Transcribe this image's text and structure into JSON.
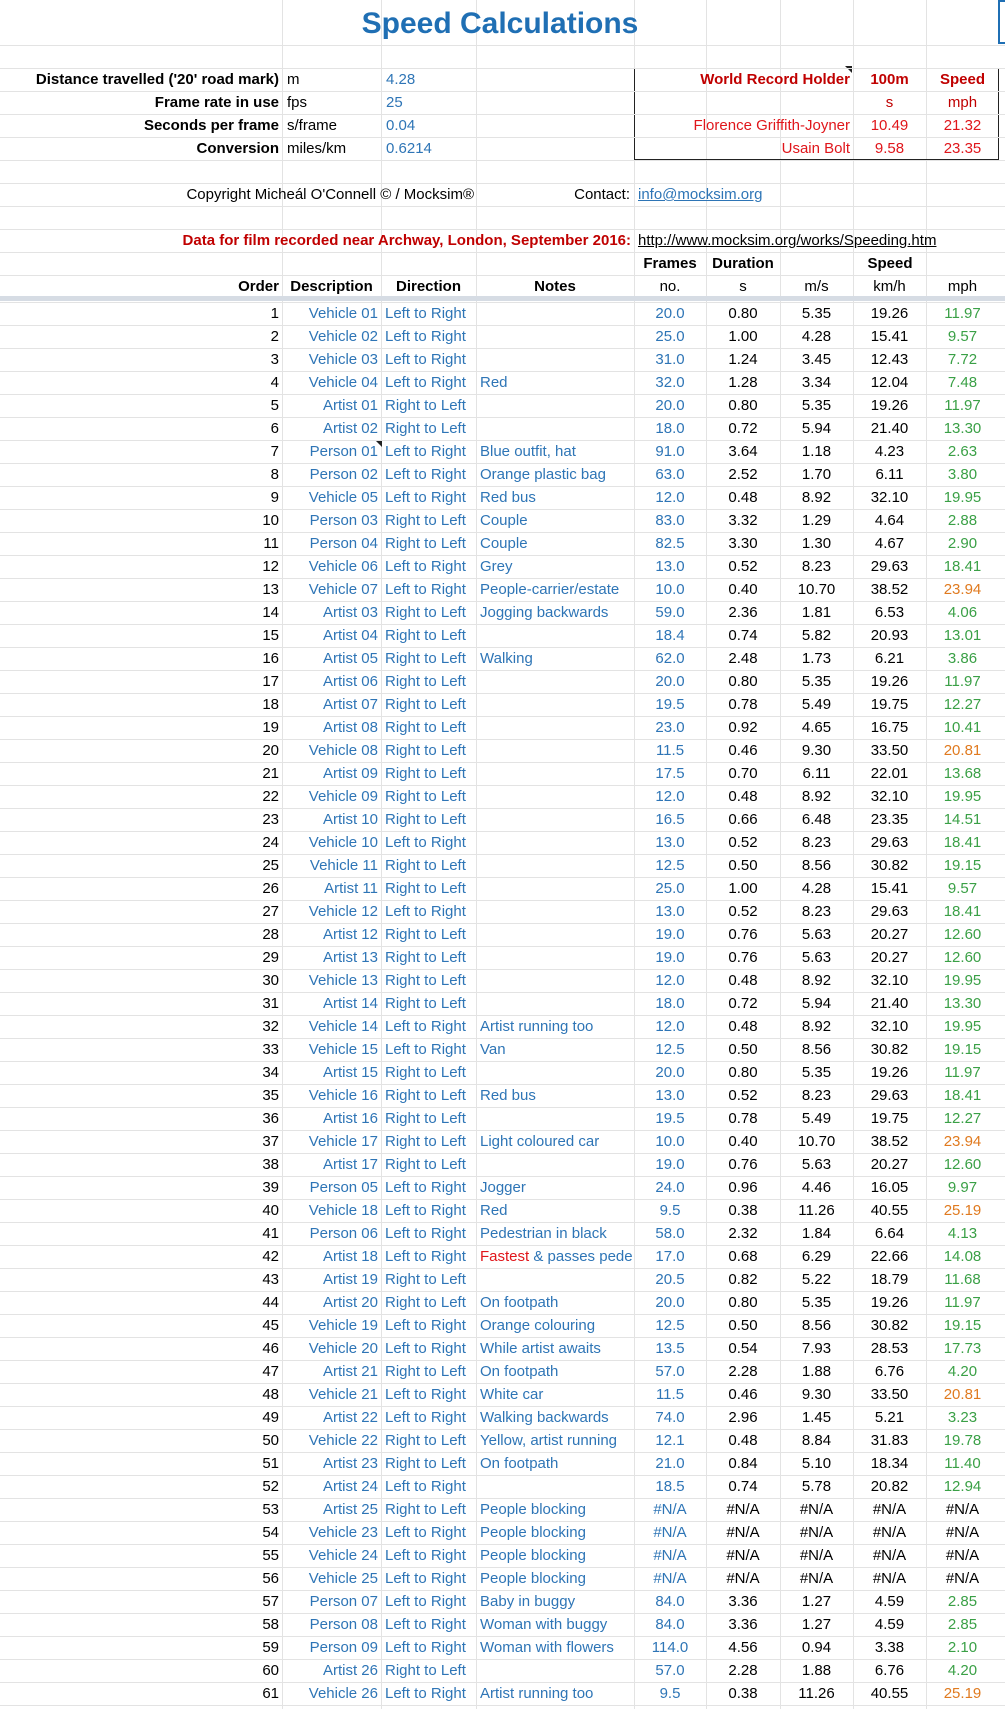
{
  "title": "Speed Calculations",
  "params": [
    {
      "label": "Distance travelled ('20' road mark)",
      "unit": "m",
      "value": "4.28"
    },
    {
      "label": "Frame rate in use",
      "unit": "fps",
      "value": "25"
    },
    {
      "label": "Seconds per frame",
      "unit": "s/frame",
      "value": "0.04"
    },
    {
      "label": "Conversion",
      "unit": "miles/km",
      "value": "0.6214"
    }
  ],
  "world_record": {
    "header": {
      "holder": "World Record Holder",
      "dist": "100m",
      "speed": "Speed"
    },
    "units": {
      "dist": "s",
      "speed": "mph"
    },
    "rows": [
      {
        "name": "Florence Griffith-Joyner",
        "time": "10.49",
        "speed": "21.32"
      },
      {
        "name": "Usain Bolt",
        "time": "9.58",
        "speed": "23.35"
      }
    ]
  },
  "copyright": "Copyright Micheál O'Connell © / Mocksim®",
  "contact_label": "Contact:",
  "contact_email": "info@mocksim.org",
  "data_note": "Data for film recorded near Archway, London, September 2016:",
  "data_url": "http://www.mocksim.org/works/Speeding.htm",
  "headers": {
    "frames": "Frames",
    "duration": "Duration",
    "speed": "Speed",
    "order": "Order",
    "description": "Description",
    "direction": "Direction",
    "notes": "Notes",
    "no": "no.",
    "s": "s",
    "ms": "m/s",
    "kmh": "km/h",
    "mph": "mph"
  },
  "rows": [
    [
      "1",
      "Vehicle 01",
      "Left to Right",
      "",
      "20.0",
      "0.80",
      "5.35",
      "19.26",
      "11.97"
    ],
    [
      "2",
      "Vehicle 02",
      "Left to Right",
      "",
      "25.0",
      "1.00",
      "4.28",
      "15.41",
      "9.57"
    ],
    [
      "3",
      "Vehicle 03",
      "Left to Right",
      "",
      "31.0",
      "1.24",
      "3.45",
      "12.43",
      "7.72"
    ],
    [
      "4",
      "Vehicle 04",
      "Left to Right",
      "Red",
      "32.0",
      "1.28",
      "3.34",
      "12.04",
      "7.48"
    ],
    [
      "5",
      "Artist 01",
      "Right  to Left",
      "",
      "20.0",
      "0.80",
      "5.35",
      "19.26",
      "11.97"
    ],
    [
      "6",
      "Artist 02",
      "Right  to Left",
      "",
      "18.0",
      "0.72",
      "5.94",
      "21.40",
      "13.30"
    ],
    [
      "7",
      "Person 01",
      "Left to Right",
      "Blue outfit, hat",
      "91.0",
      "3.64",
      "1.18",
      "4.23",
      "2.63"
    ],
    [
      "8",
      "Person 02",
      "Left to Right",
      "Orange plastic bag",
      "63.0",
      "2.52",
      "1.70",
      "6.11",
      "3.80"
    ],
    [
      "9",
      "Vehicle 05",
      "Left to Right",
      "Red bus",
      "12.0",
      "0.48",
      "8.92",
      "32.10",
      "19.95"
    ],
    [
      "10",
      "Person 03",
      "Right  to Left",
      "Couple",
      "83.0",
      "3.32",
      "1.29",
      "4.64",
      "2.88"
    ],
    [
      "11",
      "Person 04",
      "Right  to Left",
      "Couple",
      "82.5",
      "3.30",
      "1.30",
      "4.67",
      "2.90"
    ],
    [
      "12",
      "Vehicle 06",
      "Left to Right",
      "Grey",
      "13.0",
      "0.52",
      "8.23",
      "29.63",
      "18.41"
    ],
    [
      "13",
      "Vehicle 07",
      "Left to Right",
      "People-carrier/estate",
      "10.0",
      "0.40",
      "10.70",
      "38.52",
      "23.94"
    ],
    [
      "14",
      "Artist 03",
      "Right  to Left",
      "Jogging backwards",
      "59.0",
      "2.36",
      "1.81",
      "6.53",
      "4.06"
    ],
    [
      "15",
      "Artist 04",
      "Right  to Left",
      "",
      "18.4",
      "0.74",
      "5.82",
      "20.93",
      "13.01"
    ],
    [
      "16",
      "Artist 05",
      "Right  to Left",
      "Walking",
      "62.0",
      "2.48",
      "1.73",
      "6.21",
      "3.86"
    ],
    [
      "17",
      "Artist 06",
      "Right  to Left",
      "",
      "20.0",
      "0.80",
      "5.35",
      "19.26",
      "11.97"
    ],
    [
      "18",
      "Artist 07",
      "Right  to Left",
      "",
      "19.5",
      "0.78",
      "5.49",
      "19.75",
      "12.27"
    ],
    [
      "19",
      "Artist 08",
      "Right  to Left",
      "",
      "23.0",
      "0.92",
      "4.65",
      "16.75",
      "10.41"
    ],
    [
      "20",
      "Vehicle 08",
      "Right  to Left",
      "",
      "11.5",
      "0.46",
      "9.30",
      "33.50",
      "20.81"
    ],
    [
      "21",
      "Artist 09",
      "Right  to Left",
      "",
      "17.5",
      "0.70",
      "6.11",
      "22.01",
      "13.68"
    ],
    [
      "22",
      "Vehicle 09",
      "Right  to Left",
      "",
      "12.0",
      "0.48",
      "8.92",
      "32.10",
      "19.95"
    ],
    [
      "23",
      "Artist 10",
      "Right  to Left",
      "",
      "16.5",
      "0.66",
      "6.48",
      "23.35",
      "14.51"
    ],
    [
      "24",
      "Vehicle 10",
      "Left to Right",
      "",
      "13.0",
      "0.52",
      "8.23",
      "29.63",
      "18.41"
    ],
    [
      "25",
      "Vehicle 11",
      "Right  to Left",
      "",
      "12.5",
      "0.50",
      "8.56",
      "30.82",
      "19.15"
    ],
    [
      "26",
      "Artist 11",
      "Right  to Left",
      "",
      "25.0",
      "1.00",
      "4.28",
      "15.41",
      "9.57"
    ],
    [
      "27",
      "Vehicle 12",
      "Left to Right",
      "",
      "13.0",
      "0.52",
      "8.23",
      "29.63",
      "18.41"
    ],
    [
      "28",
      "Artist 12",
      "Right  to Left",
      "",
      "19.0",
      "0.76",
      "5.63",
      "20.27",
      "12.60"
    ],
    [
      "29",
      "Artist 13",
      "Right  to Left",
      "",
      "19.0",
      "0.76",
      "5.63",
      "20.27",
      "12.60"
    ],
    [
      "30",
      "Vehicle 13",
      "Right  to Left",
      "",
      "12.0",
      "0.48",
      "8.92",
      "32.10",
      "19.95"
    ],
    [
      "31",
      "Artist 14",
      "Right  to Left",
      "",
      "18.0",
      "0.72",
      "5.94",
      "21.40",
      "13.30"
    ],
    [
      "32",
      "Vehicle 14",
      "Left to Right",
      "Artist running too",
      "12.0",
      "0.48",
      "8.92",
      "32.10",
      "19.95"
    ],
    [
      "33",
      "Vehicle 15",
      "Left to Right",
      "Van",
      "12.5",
      "0.50",
      "8.56",
      "30.82",
      "19.15"
    ],
    [
      "34",
      "Artist 15",
      "Right  to Left",
      "",
      "20.0",
      "0.80",
      "5.35",
      "19.26",
      "11.97"
    ],
    [
      "35",
      "Vehicle 16",
      "Right  to Left",
      "Red bus",
      "13.0",
      "0.52",
      "8.23",
      "29.63",
      "18.41"
    ],
    [
      "36",
      "Artist 16",
      "Right  to Left",
      "",
      "19.5",
      "0.78",
      "5.49",
      "19.75",
      "12.27"
    ],
    [
      "37",
      "Vehicle 17",
      "Right  to Left",
      "Light coloured car",
      "10.0",
      "0.40",
      "10.70",
      "38.52",
      "23.94"
    ],
    [
      "38",
      "Artist 17",
      "Right  to Left",
      "",
      "19.0",
      "0.76",
      "5.63",
      "20.27",
      "12.60"
    ],
    [
      "39",
      "Person 05",
      "Left to Right",
      "Jogger",
      "24.0",
      "0.96",
      "4.46",
      "16.05",
      "9.97"
    ],
    [
      "40",
      "Vehicle 18",
      "Left to Right",
      "Red",
      "9.5",
      "0.38",
      "11.26",
      "40.55",
      "25.19"
    ],
    [
      "41",
      "Person 06",
      "Left to Right",
      "Pedestrian in black",
      "58.0",
      "2.32",
      "1.84",
      "6.64",
      "4.13"
    ],
    [
      "42",
      "Artist 18",
      "Left to Right",
      "Fastest & passes pede",
      "17.0",
      "0.68",
      "6.29",
      "22.66",
      "14.08"
    ],
    [
      "43",
      "Artist 19",
      "Right  to Left",
      "",
      "20.5",
      "0.82",
      "5.22",
      "18.79",
      "11.68"
    ],
    [
      "44",
      "Artist 20",
      "Right  to Left",
      "On footpath",
      "20.0",
      "0.80",
      "5.35",
      "19.26",
      "11.97"
    ],
    [
      "45",
      "Vehicle 19",
      "Left to Right",
      "Orange colouring",
      "12.5",
      "0.50",
      "8.56",
      "30.82",
      "19.15"
    ],
    [
      "46",
      "Vehicle 20",
      "Left to Right",
      "While artist awaits",
      "13.5",
      "0.54",
      "7.93",
      "28.53",
      "17.73"
    ],
    [
      "47",
      "Artist 21",
      "Right  to Left",
      "On footpath",
      "57.0",
      "2.28",
      "1.88",
      "6.76",
      "4.20"
    ],
    [
      "48",
      "Vehicle 21",
      "Left to Right",
      "White car",
      "11.5",
      "0.46",
      "9.30",
      "33.50",
      "20.81"
    ],
    [
      "49",
      "Artist 22",
      "Left to Right",
      "Walking backwards",
      "74.0",
      "2.96",
      "1.45",
      "5.21",
      "3.23"
    ],
    [
      "50",
      "Vehicle 22",
      "Right  to Left",
      "Yellow, artist running",
      "12.1",
      "0.48",
      "8.84",
      "31.83",
      "19.78"
    ],
    [
      "51",
      "Artist 23",
      "Right  to Left",
      "On footpath",
      "21.0",
      "0.84",
      "5.10",
      "18.34",
      "11.40"
    ],
    [
      "52",
      "Artist 24",
      "Left to Right",
      "",
      "18.5",
      "0.74",
      "5.78",
      "20.82",
      "12.94"
    ],
    [
      "53",
      "Artist 25",
      "Right  to Left",
      "People blocking",
      "#N/A",
      "#N/A",
      "#N/A",
      "#N/A",
      "#N/A"
    ],
    [
      "54",
      "Vehicle 23",
      "Left to Right",
      "People blocking",
      "#N/A",
      "#N/A",
      "#N/A",
      "#N/A",
      "#N/A"
    ],
    [
      "55",
      "Vehicle 24",
      "Left to Right",
      "People blocking",
      "#N/A",
      "#N/A",
      "#N/A",
      "#N/A",
      "#N/A"
    ],
    [
      "56",
      "Vehicle 25",
      "Left to Right",
      "People blocking",
      "#N/A",
      "#N/A",
      "#N/A",
      "#N/A",
      "#N/A"
    ],
    [
      "57",
      "Person 07",
      "Left to Right",
      "Baby in buggy",
      "84.0",
      "3.36",
      "1.27",
      "4.59",
      "2.85"
    ],
    [
      "58",
      "Person 08",
      "Left to Right",
      "Woman with buggy",
      "84.0",
      "3.36",
      "1.27",
      "4.59",
      "2.85"
    ],
    [
      "59",
      "Person 09",
      "Left to Right",
      "Woman with flowers",
      "114.0",
      "4.56",
      "0.94",
      "3.38",
      "2.10"
    ],
    [
      "60",
      "Artist 26",
      "Right  to Left",
      "",
      "57.0",
      "2.28",
      "1.88",
      "6.76",
      "4.20"
    ],
    [
      "61",
      "Vehicle 26",
      "Left to Right",
      "Artist running too",
      "9.5",
      "0.38",
      "11.26",
      "40.55",
      "25.19"
    ]
  ],
  "colors": {
    "accent": "#2e75b6",
    "title": "#1f6fb4",
    "header_red": "#c00000",
    "fast": "#e07a1f",
    "normal": "#3aa046",
    "na": "#000000"
  }
}
